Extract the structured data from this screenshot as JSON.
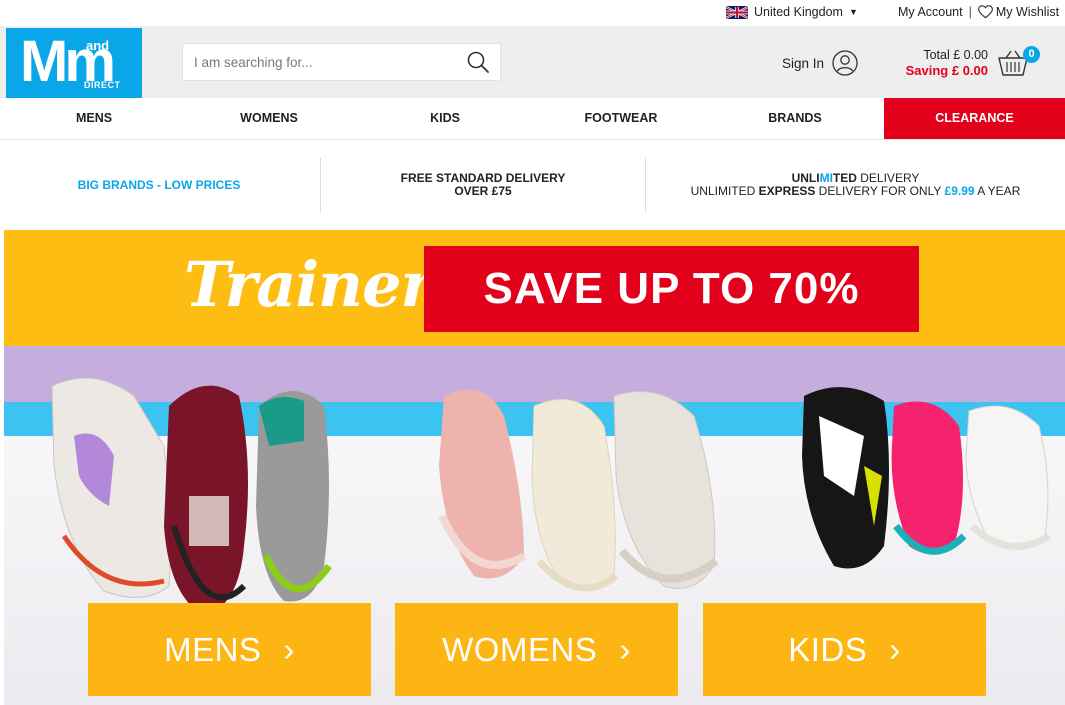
{
  "utility": {
    "country": "United Kingdom",
    "account": "My Account",
    "separator": "|",
    "wishlist": "My Wishlist"
  },
  "header": {
    "logo": {
      "big": "Mm",
      "and": "and",
      "direct": "DIRECT"
    },
    "search_placeholder": "I am searching for...",
    "sign_in": "Sign In",
    "total": "Total £ 0.00",
    "saving": "Saving £ 0.00",
    "basket_count": "0"
  },
  "nav": {
    "items": [
      "MENS",
      "WOMENS",
      "KIDS",
      "FOOTWEAR",
      "BRANDS",
      "CLEARANCE"
    ]
  },
  "usp": {
    "left": "BIG BRANDS - LOW PRICES",
    "middle_line1": "FREE STANDARD DELIVERY",
    "middle_line2": "OVER £75",
    "right_unli": "UNLI",
    "right_mi": "MI",
    "right_ted": "TED",
    "right_delivery": " DELIVERY",
    "right_line2_a": "UNLIMITED ",
    "right_line2_b": "EXPRESS",
    "right_line2_c": " DELIVERY FOR ONLY ",
    "right_line2_price": "£9.99",
    "right_line2_d": " A YEAR"
  },
  "banner": {
    "script_title": "Trainers",
    "save_text": "SAVE UP TO 70%",
    "ctas": [
      "MENS",
      "WOMENS",
      "KIDS"
    ],
    "chevron": "›"
  },
  "colors": {
    "brand_blue": "#0aa7e8",
    "sale_red": "#e2001a",
    "banner_yellow": "#fdbd12",
    "cta_orange": "#fdb514"
  }
}
